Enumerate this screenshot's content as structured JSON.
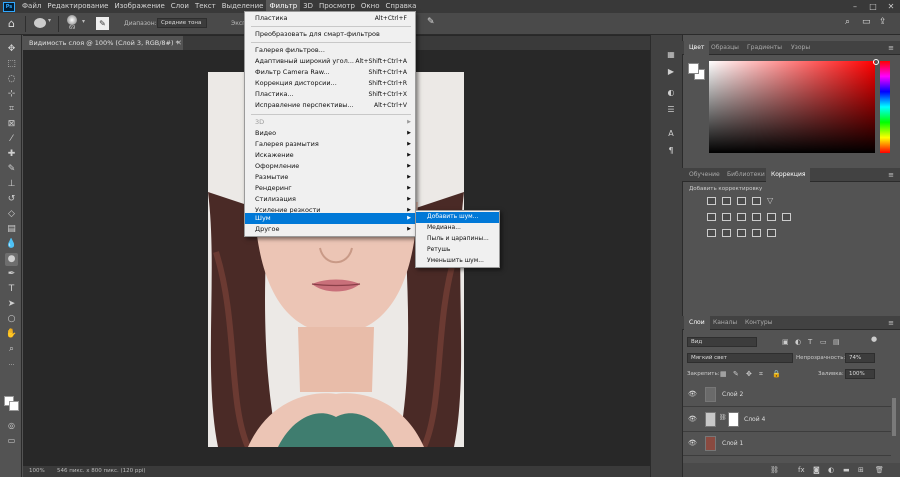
{
  "menubar": {
    "items": [
      "Файл",
      "Редактирование",
      "Изображение",
      "Слои",
      "Текст",
      "Выделение",
      "Фильтр",
      "3D",
      "Просмотр",
      "Окно",
      "Справка"
    ],
    "active": "Фильтр",
    "app_badge": "Ps"
  },
  "options_bar": {
    "brush_size": "69",
    "range_label": "Диапазон:",
    "range_value": "Средние тона",
    "exposure_label": "Экспо"
  },
  "document": {
    "tab_title": "Видимость слоя @ 100% (Слой 3, RGB/8#) *",
    "zoom": "100%",
    "doc_info": "546 пикс. x 800 пикс. (120 ppi)"
  },
  "filter_menu": {
    "items": [
      {
        "label": "Пластика",
        "shortcut": "Alt+Ctrl+F"
      },
      {
        "label": "Преобразовать для смарт-фильтров",
        "shortcut": ""
      },
      {
        "label": "Галерея фильтров...",
        "shortcut": ""
      },
      {
        "label": "Адаптивный широкий угол...",
        "shortcut": "Alt+Shift+Ctrl+A"
      },
      {
        "label": "Фильтр Camera Raw...",
        "shortcut": "Shift+Ctrl+A"
      },
      {
        "label": "Коррекция дисторсии...",
        "shortcut": "Shift+Ctrl+R"
      },
      {
        "label": "Пластика...",
        "shortcut": "Shift+Ctrl+X"
      },
      {
        "label": "Исправление перспективы...",
        "shortcut": "Alt+Ctrl+V"
      },
      {
        "label": "3D",
        "shortcut": ""
      },
      {
        "label": "Видео",
        "shortcut": ""
      },
      {
        "label": "Галерея размытия",
        "shortcut": ""
      },
      {
        "label": "Искажение",
        "shortcut": ""
      },
      {
        "label": "Оформление",
        "shortcut": ""
      },
      {
        "label": "Размытие",
        "shortcut": ""
      },
      {
        "label": "Рендеринг",
        "shortcut": ""
      },
      {
        "label": "Стилизация",
        "shortcut": ""
      },
      {
        "label": "Усиление резкости",
        "shortcut": ""
      },
      {
        "label": "Шум",
        "shortcut": ""
      },
      {
        "label": "Другое",
        "shortcut": ""
      }
    ]
  },
  "noise_submenu": {
    "items": [
      "Добавить шум...",
      "Медиана...",
      "Пыль и царапины...",
      "Ретушь",
      "Уменьшить шум..."
    ]
  },
  "color_panel": {
    "tabs": [
      "Цвет",
      "Образцы",
      "Градиенты",
      "Узоры"
    ],
    "hue_color": "#ff0000"
  },
  "adjust_panel": {
    "tabs": [
      "Обучение",
      "Библиотеки",
      "Коррекция"
    ],
    "subtitle": "Добавить корректировку"
  },
  "layers_panel": {
    "tabs": [
      "Слои",
      "Каналы",
      "Контуры"
    ],
    "filter_kind": "Вид",
    "blend_mode": "Мягкий свет",
    "opacity_label": "Непрозрачность:",
    "opacity": "74%",
    "lock_label": "Закрепить:",
    "fill_label": "Заливка:",
    "fill": "100%",
    "layers": [
      "Слой 2",
      "Слой 4",
      "Слой 1"
    ]
  }
}
